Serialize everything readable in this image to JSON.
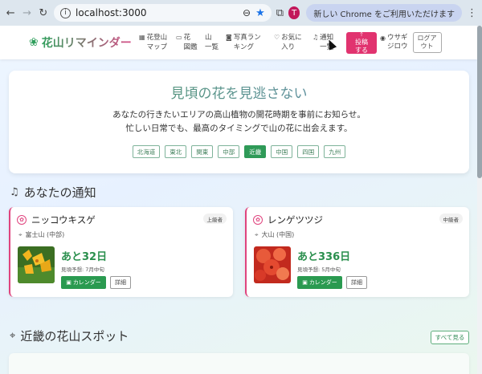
{
  "browser": {
    "url": "localhost:3000",
    "profile_initial": "T",
    "update_label": "新しい Chrome をご利用いただけます"
  },
  "header": {
    "logo": "花山リマインダー",
    "nav": [
      {
        "label": "花登山\nマップ",
        "icon": "map-icon"
      },
      {
        "label": "花\n図鑑",
        "icon": "book-icon"
      },
      {
        "label": "山\n一覧",
        "icon": "mountain-icon"
      },
      {
        "label": "写真ラン\nキング",
        "icon": "camera-icon"
      },
      {
        "label": "お気に\n入り",
        "icon": "heart-icon"
      },
      {
        "label": "通知\n一覧",
        "icon": "bell-icon"
      }
    ],
    "post_label": "投稿\nする",
    "user_name": "ウサギ\nジロウ",
    "logout_label": "ログア\nウト"
  },
  "hero": {
    "title": "見頃の花を見逃さない",
    "line1": "あなたの行きたいエリアの高山植物の開花時期を事前にお知らせ。",
    "line2": "忙しい日常でも、最高のタイミングで山の花に出会えます。",
    "regions": [
      "北海道",
      "東北",
      "関東",
      "中部",
      "近畿",
      "中国",
      "四国",
      "九州"
    ],
    "active_region": "近畿"
  },
  "notifications": {
    "title": "あなたの通知",
    "cards": [
      {
        "name": "ニッコウキスゲ",
        "level": "上級者",
        "location": "富士山 (中部)",
        "days": "あと32日",
        "forecast": "見頃予想: 7月中旬",
        "calendar_label": "カレンダー",
        "detail_label": "詳細",
        "photo_color": "#e8b020"
      },
      {
        "name": "レンゲツツジ",
        "level": "中級者",
        "location": "大山 (中国)",
        "days": "あと336日",
        "forecast": "見頃予想: 5月中旬",
        "calendar_label": "カレンダー",
        "detail_label": "詳細",
        "photo_color": "#e0402a"
      }
    ]
  },
  "spots": {
    "title": "近畿の花山スポット",
    "see_all_label": "すべて見る"
  },
  "colors": {
    "accent_green": "#2a9a50",
    "accent_pink": "#e1336f"
  }
}
